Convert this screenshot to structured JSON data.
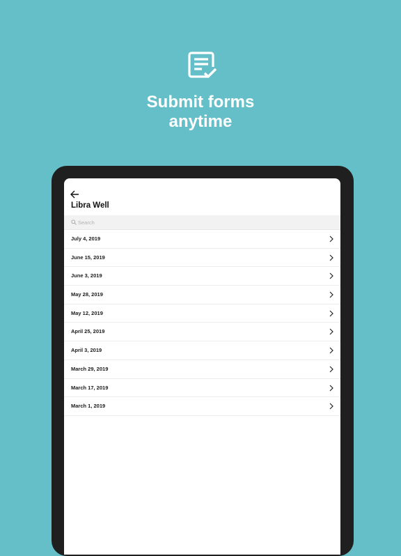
{
  "hero": {
    "icon": "form-check-icon",
    "headline_line1": "Submit forms",
    "headline_line2": "anytime"
  },
  "screen": {
    "back_icon": "arrow-left-icon",
    "title": "Libra Well",
    "search": {
      "placeholder": "Search",
      "icon": "search-icon"
    },
    "items": [
      {
        "label": "July 4, 2019"
      },
      {
        "label": "June 15, 2019"
      },
      {
        "label": "June 3, 2019"
      },
      {
        "label": "May 28, 2019"
      },
      {
        "label": "May 12, 2019"
      },
      {
        "label": "April 25, 2019"
      },
      {
        "label": "April 3, 2019"
      },
      {
        "label": "March 29, 2019"
      },
      {
        "label": "March 17, 2019"
      },
      {
        "label": "March 1, 2019"
      }
    ]
  },
  "colors": {
    "background": "#65bfc9",
    "device": "#1f1f1f",
    "screen": "#ffffff",
    "search_bar": "#f2f2f2"
  }
}
